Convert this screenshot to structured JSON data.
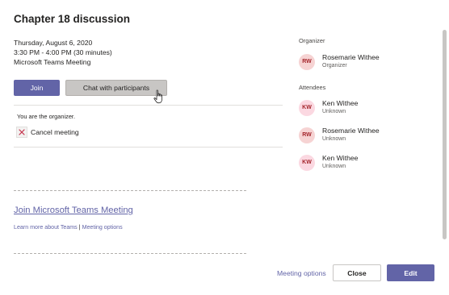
{
  "title": "Chapter 18 discussion",
  "details": {
    "date": "Thursday, August 6, 2020",
    "time": "3:30 PM - 4:00 PM (30 minutes)",
    "location": "Microsoft Teams Meeting"
  },
  "actions": {
    "join_label": "Join",
    "chat_label": "Chat with participants"
  },
  "organizer_note": "You are the organizer.",
  "cancel_label": "Cancel meeting",
  "join_link": "Join Microsoft Teams Meeting",
  "learn_more": "Learn more about Teams",
  "learn_separator": "|",
  "meeting_options_link": "Meeting options",
  "organizer": {
    "heading": "Organizer",
    "initials": "RW",
    "name": "Rosemarie Withee",
    "role": "Organizer"
  },
  "attendees": {
    "heading": "Attendees",
    "list": [
      {
        "initials": "KW",
        "name": "Ken Withee",
        "status": "Unknown"
      },
      {
        "initials": "RW",
        "name": "Rosemarie Withee",
        "status": "Unknown"
      },
      {
        "initials": "KW",
        "name": "Ken Withee",
        "status": "Unknown"
      }
    ]
  },
  "footer": {
    "meeting_options": "Meeting options",
    "close_label": "Close",
    "edit_label": "Edit"
  },
  "colors": {
    "accent": "#6264a7",
    "avatar_bg": "#f6d3d3",
    "avatar_text": "#a4262c"
  }
}
